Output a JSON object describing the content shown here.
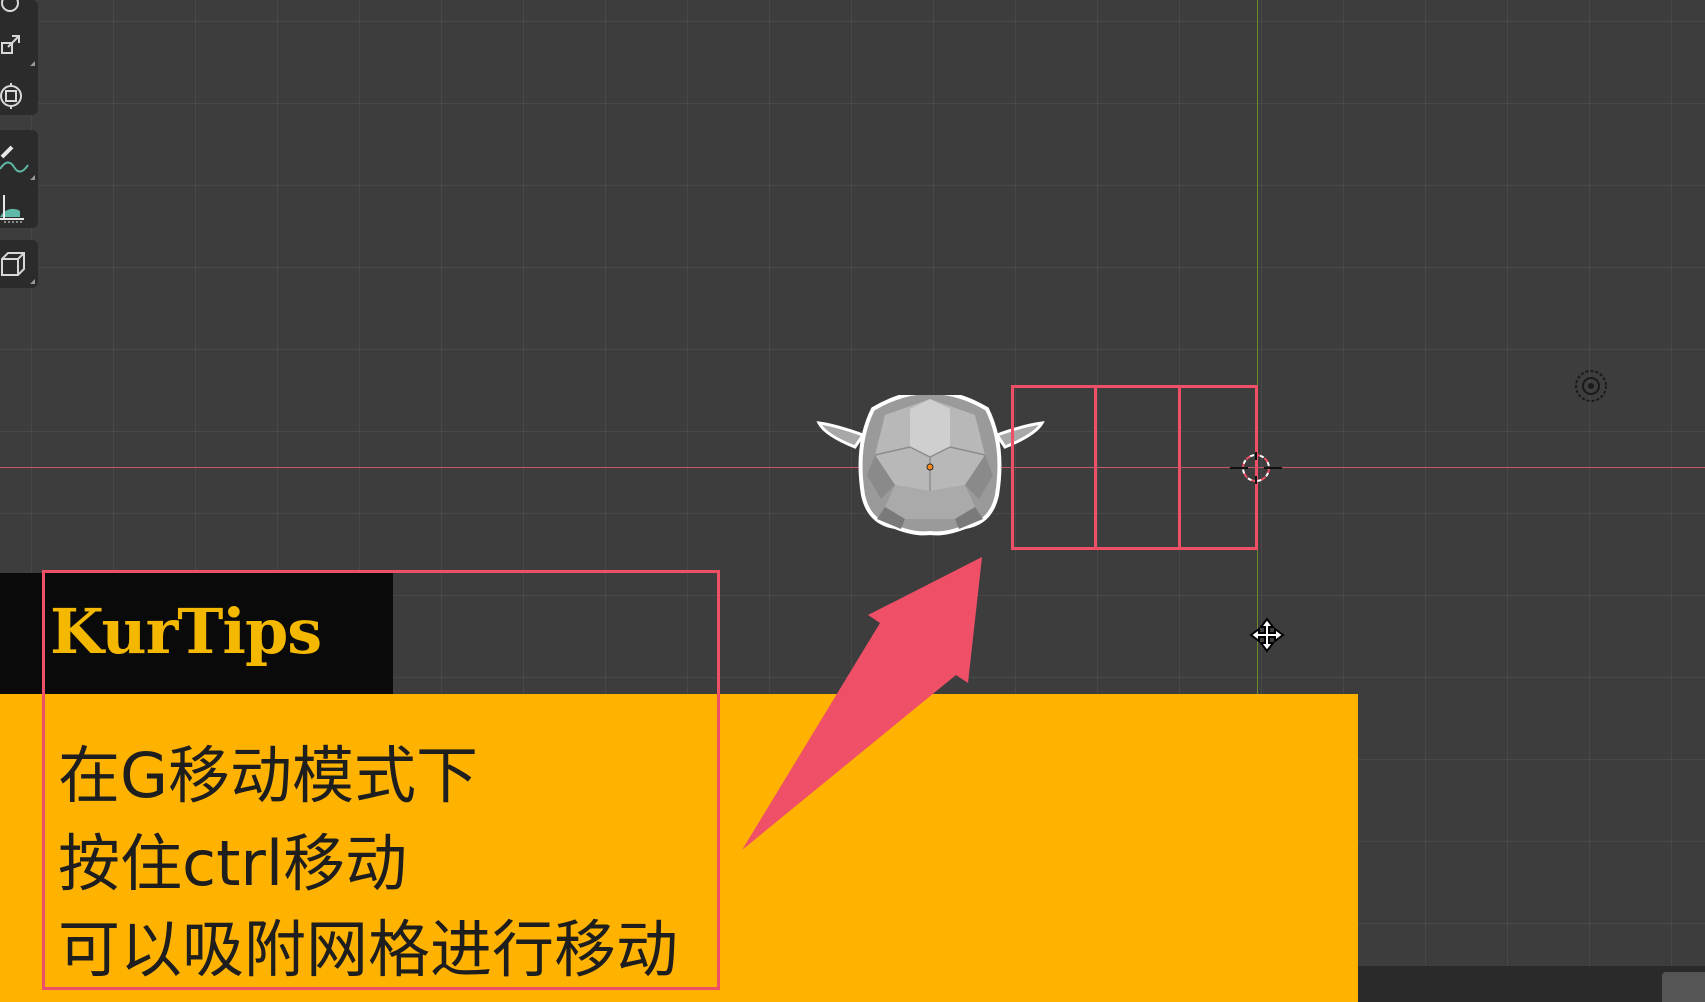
{
  "viewport": {
    "background_color": "#3d3d3d",
    "axis_x_color": "#c7566b",
    "axis_y_color": "#6e8a2c"
  },
  "toolbar": {
    "tools": [
      {
        "name": "rotate-icon"
      },
      {
        "name": "scale-icon"
      },
      {
        "name": "transform-icon"
      },
      {
        "name": "annotate-icon"
      },
      {
        "name": "measure-icon"
      },
      {
        "name": "add-cube-icon"
      }
    ]
  },
  "overlay": {
    "brand": "KurTips",
    "brand_color": "#f5b800",
    "panel_color": "#ffb300",
    "highlight_color": "#ef5067",
    "lines": [
      "在G移动模式下",
      "按住ctrl移动",
      "可以吸附网格进行移动"
    ]
  }
}
